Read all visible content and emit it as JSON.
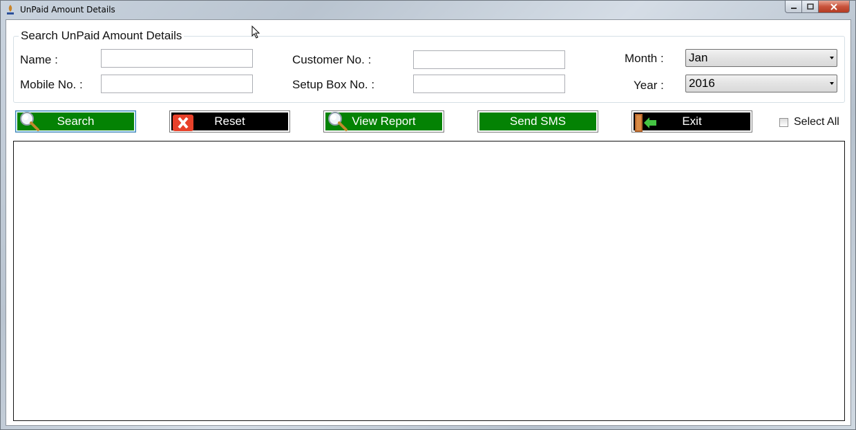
{
  "window": {
    "title": "UnPaid Amount Details",
    "app_icon": "app-logo-icon",
    "controls": [
      "minimize-icon",
      "maximize-icon",
      "close-icon"
    ]
  },
  "search": {
    "group_title": "Search UnPaid Amount Details",
    "name_label": "Name :",
    "name_value": "",
    "mobile_label": "Mobile No. :",
    "mobile_value": "",
    "customer_label": "Customer No. :",
    "customer_value": "",
    "setup_box_label": "Setup Box No. :",
    "setup_box_value": "",
    "month_label": "Month :",
    "month_value": "Jan",
    "year_label": "Year :",
    "year_value": "2016"
  },
  "toolbar": {
    "search_label": "Search",
    "reset_label": "Reset",
    "view_report_label": "View Report",
    "send_sms_label": "Send SMS",
    "exit_label": "Exit",
    "select_all_label": "Select All",
    "select_all_checked": false
  },
  "colors": {
    "green_button": "#048204",
    "black_button": "#000000"
  }
}
